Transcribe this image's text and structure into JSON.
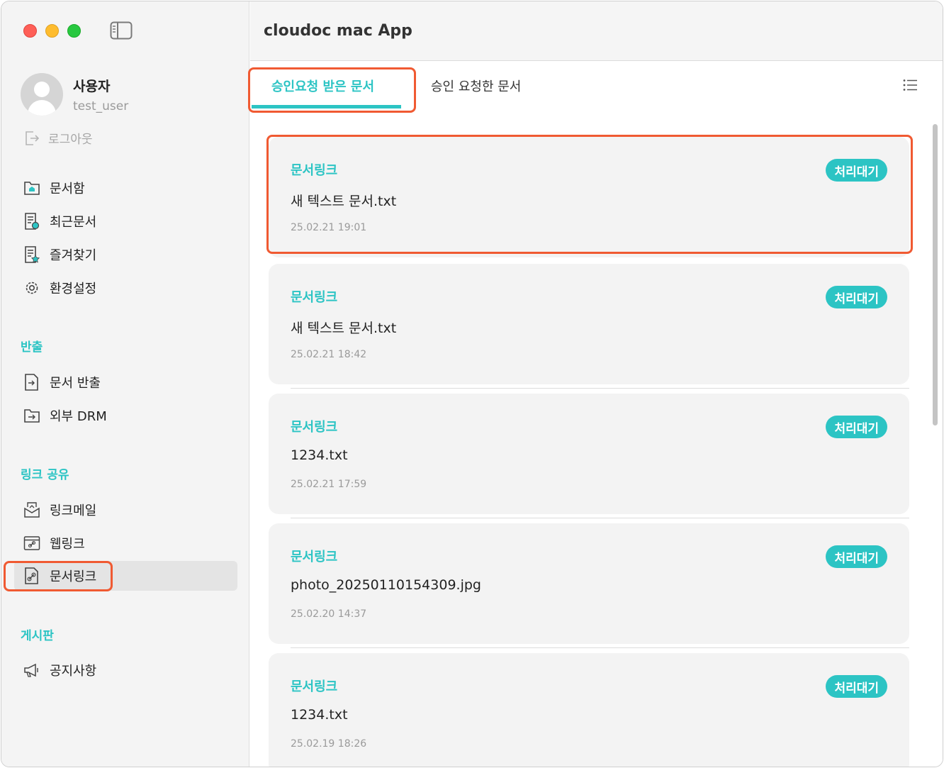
{
  "sidebar": {
    "user": {
      "name": "사용자",
      "id": "test_user"
    },
    "logout_label": "로그아웃",
    "menu": [
      {
        "label": "문서함",
        "icon": "folder-home-icon"
      },
      {
        "label": "최근문서",
        "icon": "recent-doc-icon"
      },
      {
        "label": "즐겨찾기",
        "icon": "favorite-doc-icon"
      },
      {
        "label": "환경설정",
        "icon": "gear-icon"
      }
    ],
    "sections": [
      {
        "title": "반출",
        "items": [
          {
            "label": "문서 반출",
            "icon": "doc-export-icon"
          },
          {
            "label": "외부 DRM",
            "icon": "external-drm-icon"
          }
        ]
      },
      {
        "title": "링크 공유",
        "items": [
          {
            "label": "링크메일",
            "icon": "link-mail-icon"
          },
          {
            "label": "웹링크",
            "icon": "web-link-icon"
          },
          {
            "label": "문서링크",
            "icon": "doc-link-icon",
            "active": true
          }
        ]
      },
      {
        "title": "게시판",
        "items": [
          {
            "label": "공지사항",
            "icon": "megaphone-icon"
          }
        ]
      }
    ]
  },
  "main": {
    "title": "cloudoc mac App",
    "tabs": [
      {
        "label": "승인요청 받은 문서",
        "active": true
      },
      {
        "label": "승인 요청한 문서",
        "active": false
      }
    ],
    "cards": [
      {
        "type": "문서링크",
        "file": "새 텍스트 문서.txt",
        "date": "25.02.21 19:01",
        "status": "처리대기"
      },
      {
        "type": "문서링크",
        "file": "새 텍스트 문서.txt",
        "date": "25.02.21 18:42",
        "status": "처리대기"
      },
      {
        "type": "문서링크",
        "file": "1234.txt",
        "date": "25.02.21 17:59",
        "status": "처리대기"
      },
      {
        "type": "문서링크",
        "file": "photo_20250110154309.jpg",
        "date": "25.02.20 14:37",
        "status": "처리대기"
      },
      {
        "type": "문서링크",
        "file": "1234.txt",
        "date": "25.02.19 18:26",
        "status": "처리대기"
      }
    ]
  },
  "colors": {
    "accent": "#2cc4c4",
    "highlight": "#f05a32"
  }
}
